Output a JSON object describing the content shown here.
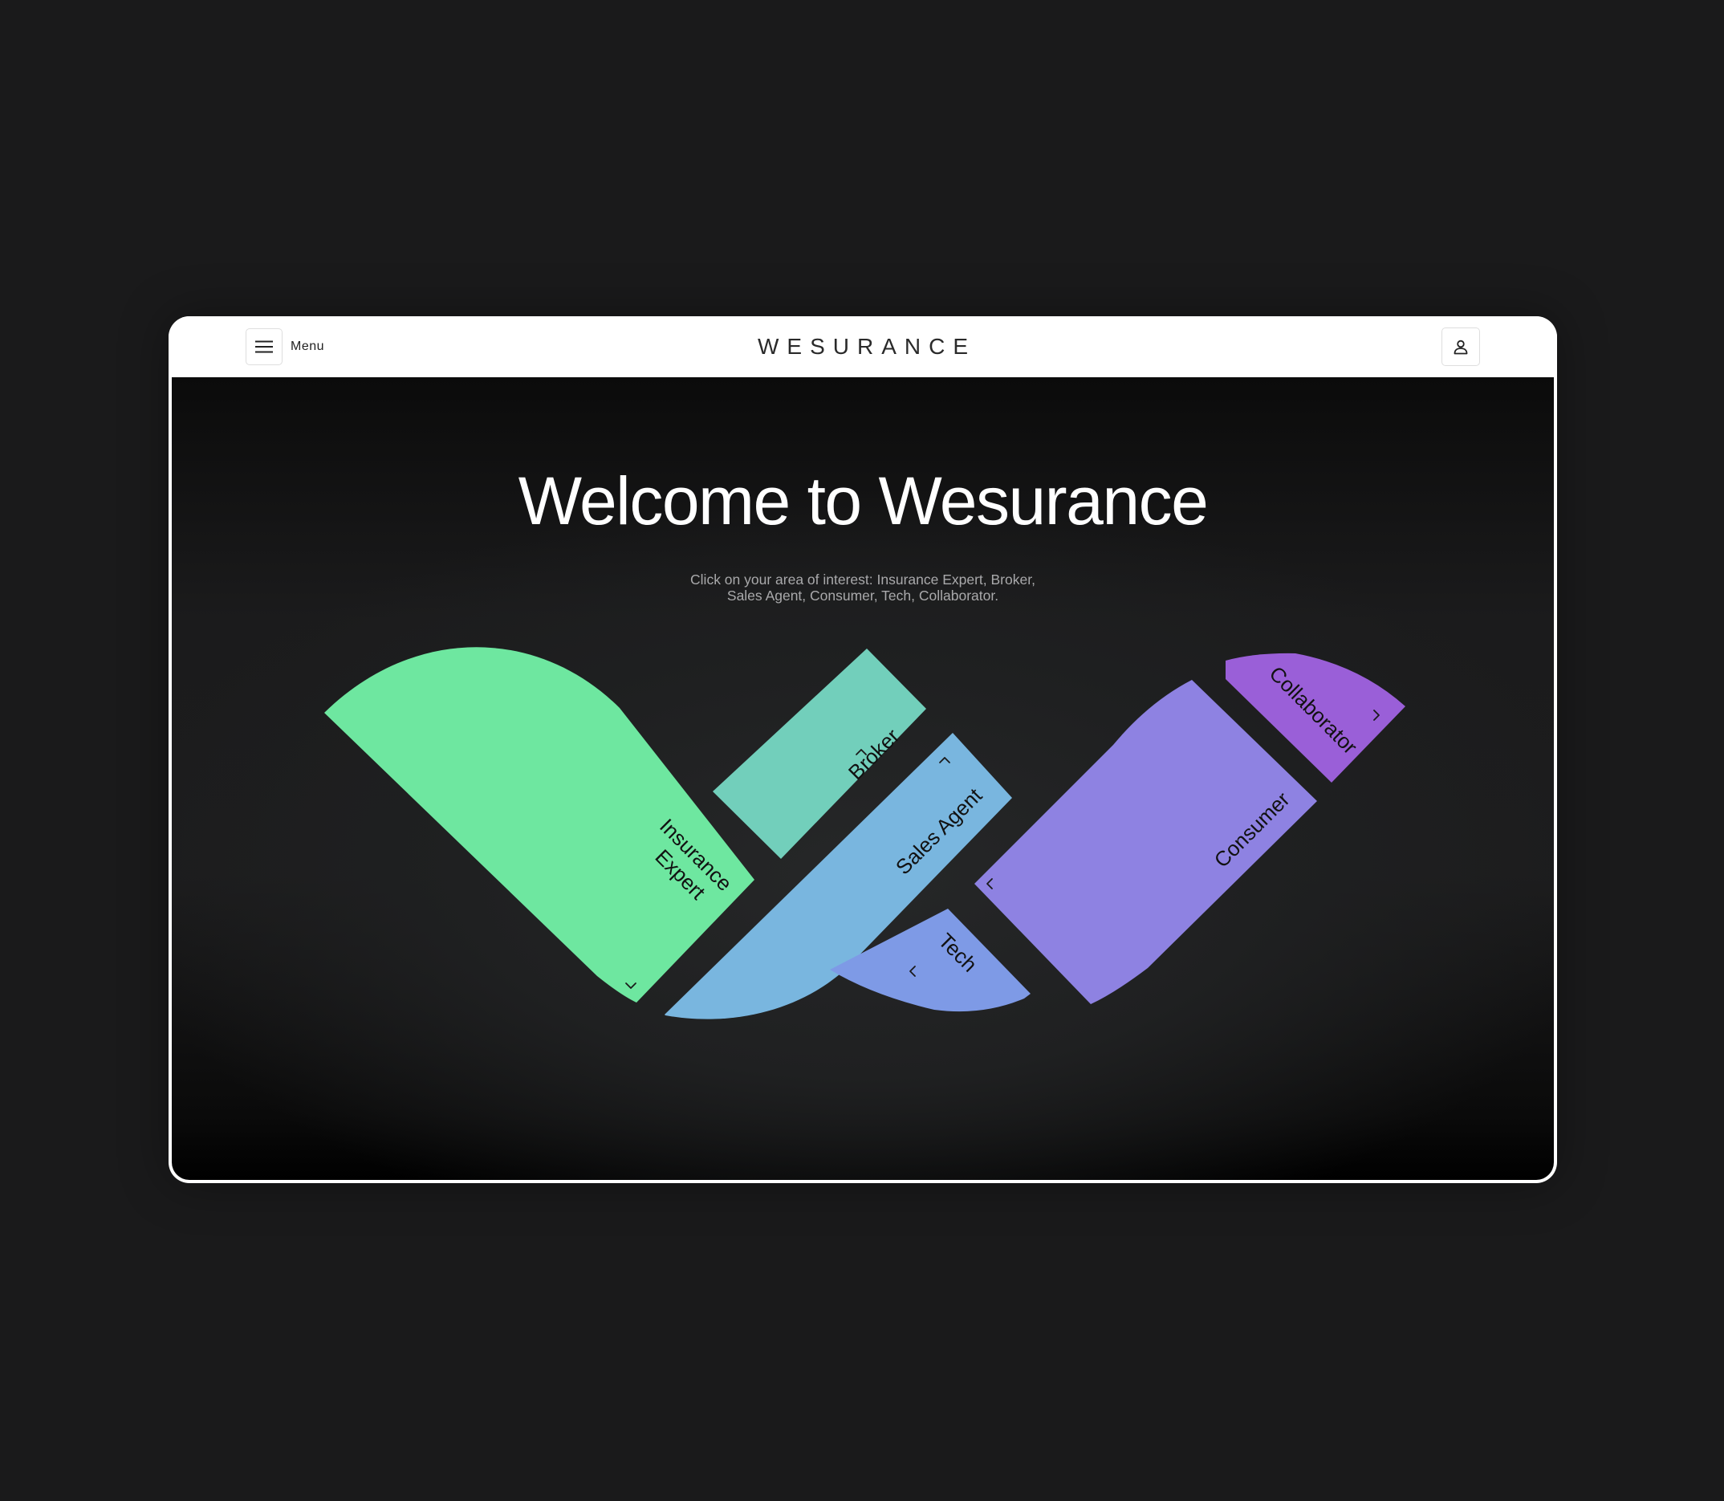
{
  "header": {
    "menu_label": "Menu",
    "logo": "WESURANCE"
  },
  "hero": {
    "title": "Welcome to Wesurance",
    "subtitle_line1": "Click on your area of interest: Insurance Expert, Broker,",
    "subtitle_line2": "Sales Agent, Consumer, Tech, Collaborator."
  },
  "areas": {
    "insurance_expert": {
      "line1": "Insurance",
      "line2": "Expert",
      "color": "#6ee7a0"
    },
    "broker": {
      "label": "Broker",
      "color": "#72cfbb"
    },
    "sales_agent": {
      "label": "Sales Agent",
      "color": "#79b6df"
    },
    "tech": {
      "label": "Tech",
      "color": "#7e9ae6"
    },
    "consumer": {
      "label": "Consumer",
      "color": "#8e82e2"
    },
    "collaborator": {
      "label": "Collaborator",
      "color": "#9a5fd8"
    }
  },
  "icons": {
    "menu": "hamburger-icon",
    "user": "user-icon",
    "arrows": "chevron-icon"
  }
}
